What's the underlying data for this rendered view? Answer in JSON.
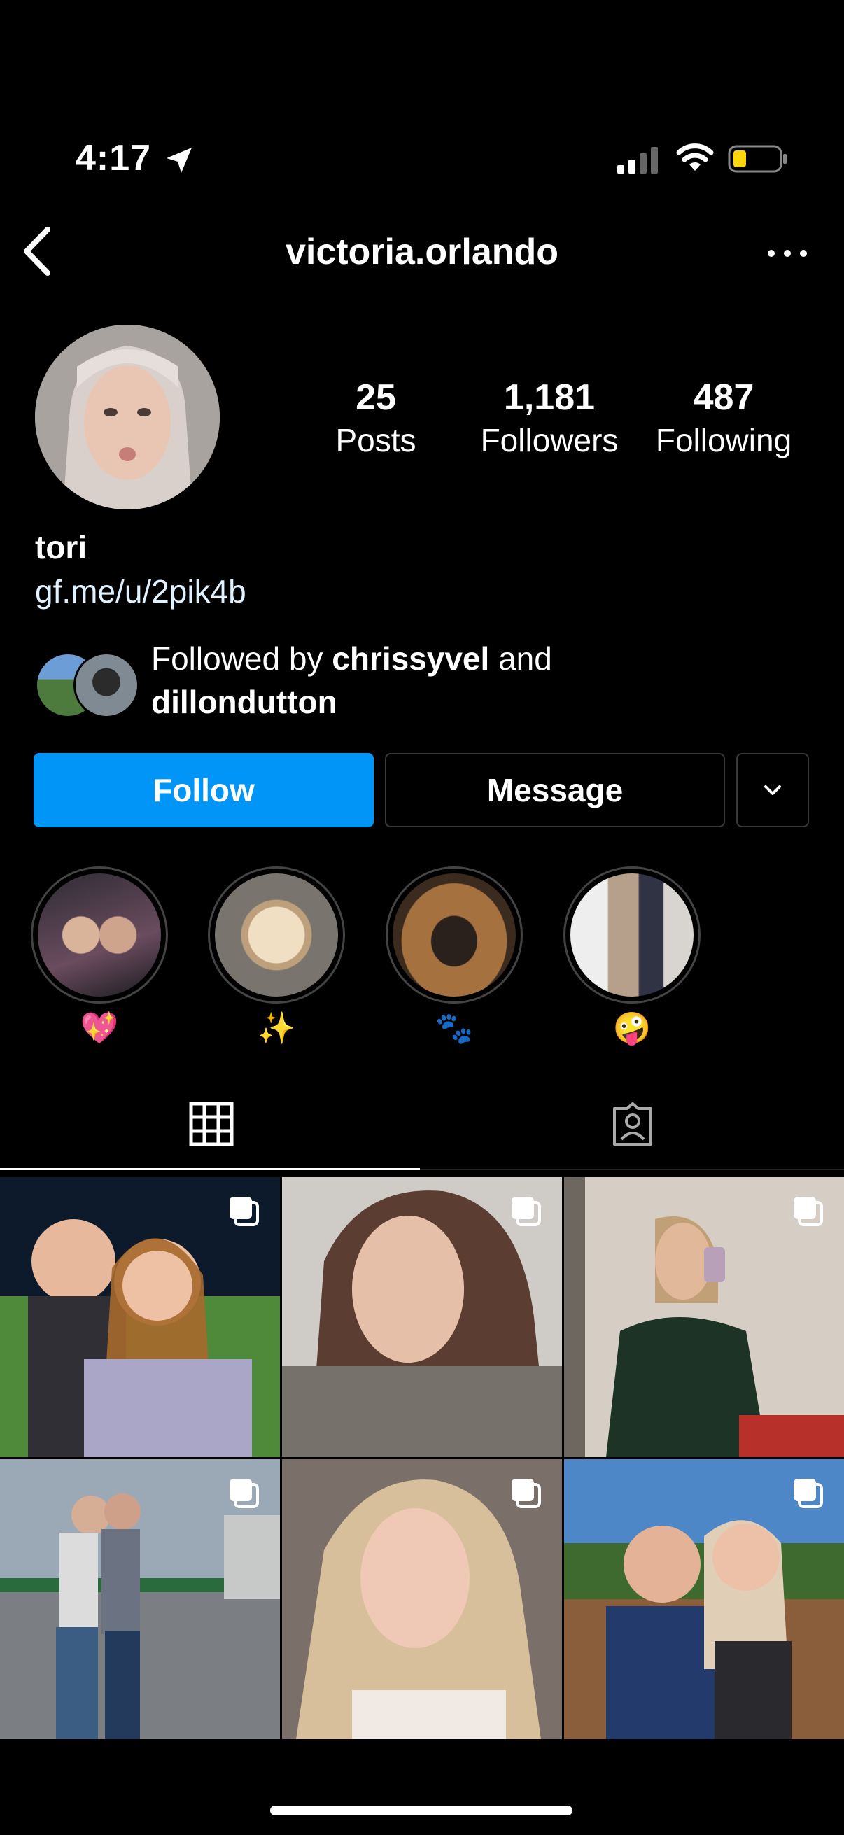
{
  "status_bar": {
    "time": "4:17"
  },
  "nav": {
    "username": "victoria.orlando",
    "back_icon": "chevron-left-icon",
    "more_icon": "ellipsis-icon"
  },
  "profile": {
    "stats": [
      {
        "count": "25",
        "label": "Posts"
      },
      {
        "count": "1,181",
        "label": "Followers"
      },
      {
        "count": "487",
        "label": "Following"
      }
    ],
    "display_name": "tori",
    "bio_link": "gf.me/u/2pik4b",
    "followed_by": {
      "prefix": "Followed by",
      "user1": "chrissyvel",
      "conj": "and",
      "user2": "dillondutton"
    }
  },
  "actions": {
    "follow": "Follow",
    "message": "Message",
    "suggest_icon": "chevron-down-icon"
  },
  "highlights": [
    {
      "emoji": "💖"
    },
    {
      "emoji": "✨"
    },
    {
      "emoji": "🐾"
    },
    {
      "emoji": "🤪"
    }
  ],
  "tabs": [
    {
      "name": "grid",
      "icon": "grid-icon",
      "active": true
    },
    {
      "name": "tagged",
      "icon": "tagged-person-icon",
      "active": false
    }
  ],
  "colors": {
    "background": "#000000",
    "follow_button": "#0095f6",
    "link": "#e0f1ff",
    "battery": "#ffd60a"
  }
}
